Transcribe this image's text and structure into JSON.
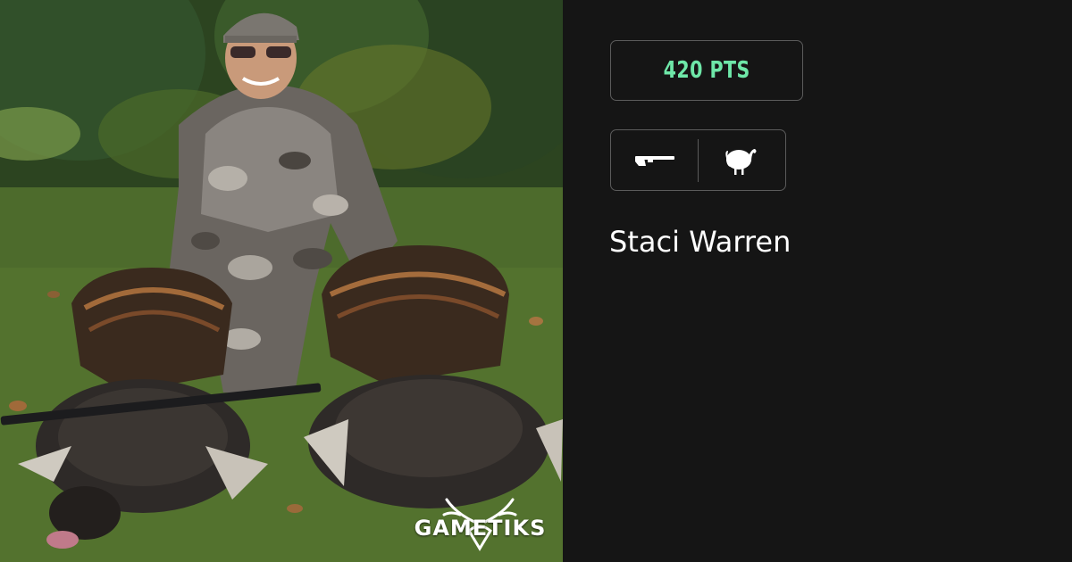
{
  "brand": {
    "logo_text": "GAMETIKS",
    "logo_icon": "deer-skull-antlers-icon"
  },
  "photo": {
    "subject": "hunter-with-two-turkeys"
  },
  "score": {
    "points_label": "420 PTS",
    "color": "#6ee7a8"
  },
  "harvest": {
    "weapon_icon": "shotgun-icon",
    "species_icon": "turkey-icon"
  },
  "hunter": {
    "name": "Staci Warren"
  },
  "colors": {
    "background": "#151515",
    "border": "#5b5b5b",
    "text": "#ffffff"
  }
}
